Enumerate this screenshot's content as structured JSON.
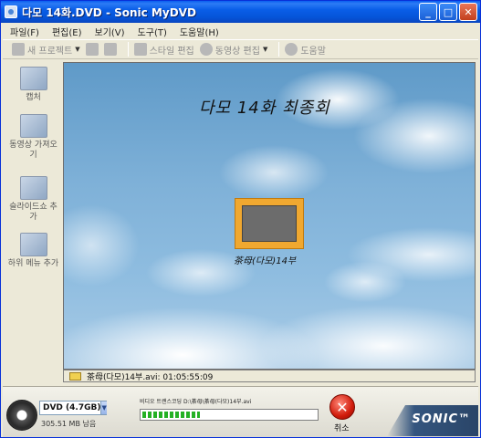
{
  "window": {
    "title": "다모 14화.DVD - Sonic MyDVD",
    "buttons": {
      "minimize": "_",
      "maximize": "□",
      "close": "✕"
    }
  },
  "menu": [
    "파일(F)",
    "편집(E)",
    "보기(V)",
    "도구(T)",
    "도움말(H)"
  ],
  "toolbar": {
    "new_project": "새 프로젝트",
    "edit_style": "스타일 편집",
    "edit_video": "동영상 편집",
    "help": "도움말"
  },
  "sidebar": [
    {
      "label": "캡처",
      "icon": "camera-icon"
    },
    {
      "label": "동영상 가져오기",
      "icon": "film-icon"
    },
    {
      "label": "슬라이드쇼 추가",
      "icon": "slideshow-icon"
    },
    {
      "label": "하위 메뉴 추가",
      "icon": "submenu-icon"
    }
  ],
  "preview": {
    "menu_title": "다모 14화 최종회",
    "thumbnail_label": "茶母(다모)14부",
    "status_text": "茶母(다모)14부.avi: 01:05:55:09"
  },
  "bottom": {
    "disc_type": "DVD (4.7GB)",
    "disc_free": "305.51 MB 남음",
    "progress_caption": "비디오 트랜스코딩 D:\\茶母\\茶母(다모)14부.avi",
    "progress_value": 0.33,
    "cancel_label": "취소",
    "brand": "SONIC™"
  },
  "colors": {
    "titlebar": "#0a5ee8",
    "thumbnail_frame": "#f0a830",
    "progress": "#24b024",
    "cancel": "#d11c0c"
  }
}
